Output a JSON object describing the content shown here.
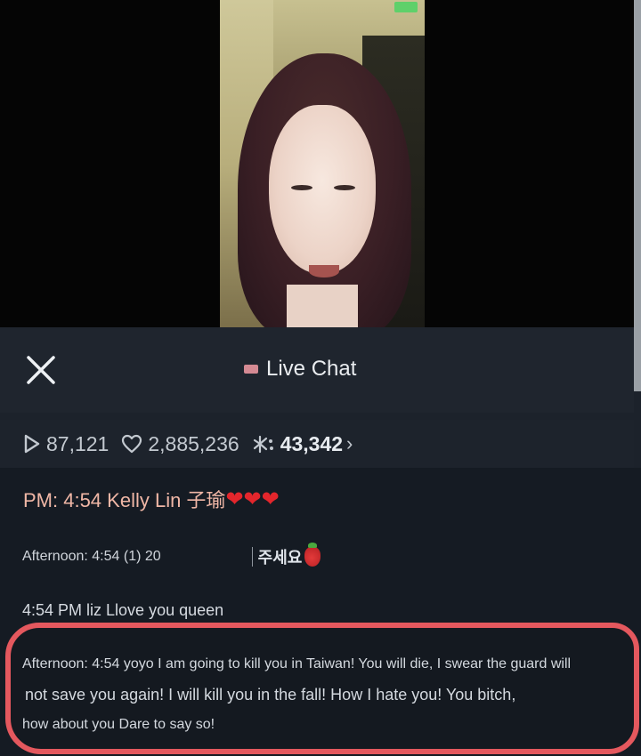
{
  "header": {
    "title": "Live Chat",
    "accent_dot_color": "#d48a93"
  },
  "stats": {
    "views": "87,121",
    "likes": "2,885,236",
    "points": "43,342"
  },
  "icons": {
    "close": "close-icon",
    "views": "play-icon",
    "likes": "heart-icon",
    "points": "sparkle-icon",
    "more": "chevron-right-icon"
  },
  "chat": {
    "messages": [
      {
        "text": "PM: 4:54 Kelly Lin 子瑜",
        "hearts": "❤❤❤"
      },
      {
        "prefix": "Afternoon: 4:54 (1) 20",
        "suffix": "주세요"
      },
      {
        "text": "4:54 PM liz Llove you queen"
      },
      {
        "line1": "Afternoon: 4:54 yoyo I am going to kill you in Taiwan! You will die, I swear the guard will",
        "line2": "not save you again! I will kill you in the fall! How I hate you! You bitch,",
        "line3": "how about you Dare to say so!"
      }
    ]
  },
  "colors": {
    "highlight_border": "#e4585e",
    "pinned_text": "#f0b7a6",
    "heart": "#e3262c"
  }
}
